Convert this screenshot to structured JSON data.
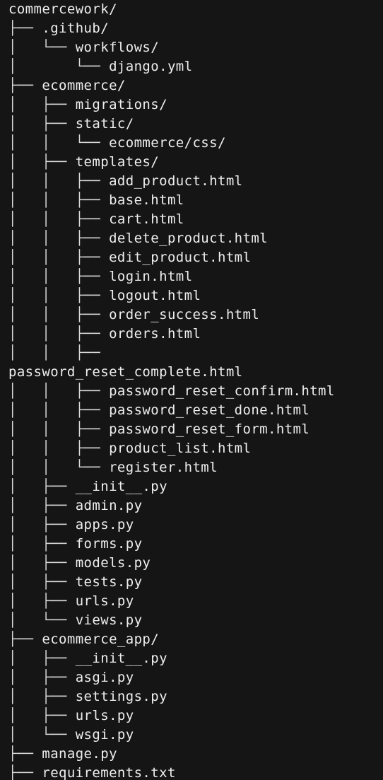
{
  "colors": {
    "background": "#151515",
    "text": "#eeeeee"
  },
  "tree": {
    "lines": [
      {
        "prefix": "",
        "name": "commercework/"
      },
      {
        "prefix": "├── ",
        "name": ".github/"
      },
      {
        "prefix": "│   └── ",
        "name": "workflows/"
      },
      {
        "prefix": "│       └── ",
        "name": "django.yml"
      },
      {
        "prefix": "├── ",
        "name": "ecommerce/"
      },
      {
        "prefix": "│   ├── ",
        "name": "migrations/"
      },
      {
        "prefix": "│   ├── ",
        "name": "static/"
      },
      {
        "prefix": "│   │   └── ",
        "name": "ecommerce/css/"
      },
      {
        "prefix": "│   ├── ",
        "name": "templates/"
      },
      {
        "prefix": "│   │   ├── ",
        "name": "add_product.html"
      },
      {
        "prefix": "│   │   ├── ",
        "name": "base.html"
      },
      {
        "prefix": "│   │   ├── ",
        "name": "cart.html"
      },
      {
        "prefix": "│   │   ├── ",
        "name": "delete_product.html"
      },
      {
        "prefix": "│   │   ├── ",
        "name": "edit_product.html"
      },
      {
        "prefix": "│   │   ├── ",
        "name": "login.html"
      },
      {
        "prefix": "│   │   ├── ",
        "name": "logout.html"
      },
      {
        "prefix": "│   │   ├── ",
        "name": "order_success.html"
      },
      {
        "prefix": "│   │   ├── ",
        "name": "orders.html"
      },
      {
        "prefix": "│   │   ├──",
        "name": ""
      },
      {
        "prefix": "",
        "name": "password_reset_complete.html"
      },
      {
        "prefix": "│   │   ├── ",
        "name": "password_reset_confirm.html"
      },
      {
        "prefix": "│   │   ├── ",
        "name": "password_reset_done.html"
      },
      {
        "prefix": "│   │   ├── ",
        "name": "password_reset_form.html"
      },
      {
        "prefix": "│   │   ├── ",
        "name": "product_list.html"
      },
      {
        "prefix": "│   │   └── ",
        "name": "register.html"
      },
      {
        "prefix": "│   ├── ",
        "name": "__init__.py"
      },
      {
        "prefix": "│   ├── ",
        "name": "admin.py"
      },
      {
        "prefix": "│   ├── ",
        "name": "apps.py"
      },
      {
        "prefix": "│   ├── ",
        "name": "forms.py"
      },
      {
        "prefix": "│   ├── ",
        "name": "models.py"
      },
      {
        "prefix": "│   ├── ",
        "name": "tests.py"
      },
      {
        "prefix": "│   ├── ",
        "name": "urls.py"
      },
      {
        "prefix": "│   └── ",
        "name": "views.py"
      },
      {
        "prefix": "├── ",
        "name": "ecommerce_app/"
      },
      {
        "prefix": "│   ├── ",
        "name": "__init__.py"
      },
      {
        "prefix": "│   ├── ",
        "name": "asgi.py"
      },
      {
        "prefix": "│   ├── ",
        "name": "settings.py"
      },
      {
        "prefix": "│   ├── ",
        "name": "urls.py"
      },
      {
        "prefix": "│   └── ",
        "name": "wsgi.py"
      },
      {
        "prefix": "├── ",
        "name": "manage.py"
      },
      {
        "prefix": "├── ",
        "name": "requirements.txt"
      }
    ]
  }
}
